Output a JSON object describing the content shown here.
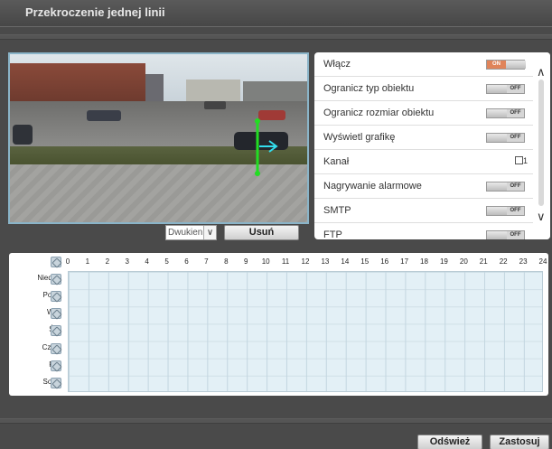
{
  "window": {
    "title": "Przekroczenie jednej linii"
  },
  "video_controls": {
    "direction_value": "Dwukien.",
    "delete_label": "Usuń"
  },
  "settings": {
    "items": [
      {
        "label": "Włącz",
        "state": "ON"
      },
      {
        "label": "Ogranicz typ obiektu",
        "state": "OFF"
      },
      {
        "label": "Ogranicz rozmiar obiektu",
        "state": "OFF"
      },
      {
        "label": "Wyświetl grafikę",
        "state": "OFF"
      },
      {
        "label": "Kanał",
        "channel": "1"
      },
      {
        "label": "Nagrywanie alarmowe",
        "state": "OFF"
      },
      {
        "label": "SMTP",
        "state": "OFF"
      },
      {
        "label": "FTP",
        "state": "OFF"
      }
    ]
  },
  "schedule": {
    "hours": [
      "0",
      "1",
      "2",
      "3",
      "4",
      "5",
      "6",
      "7",
      "8",
      "9",
      "10",
      "11",
      "12",
      "13",
      "14",
      "15",
      "16",
      "17",
      "18",
      "19",
      "20",
      "21",
      "22",
      "23",
      "24"
    ],
    "days": [
      "Niedz.",
      "Pon.",
      "Wt.",
      "Śr.",
      "Czw.",
      "Pt.",
      "Sob."
    ]
  },
  "footer": {
    "refresh_label": "Odśwież",
    "apply_label": "Zastosuj"
  },
  "colors": {
    "line": "#22dd22",
    "arrow": "#33ddee",
    "toggle_on": "#e0845a"
  }
}
